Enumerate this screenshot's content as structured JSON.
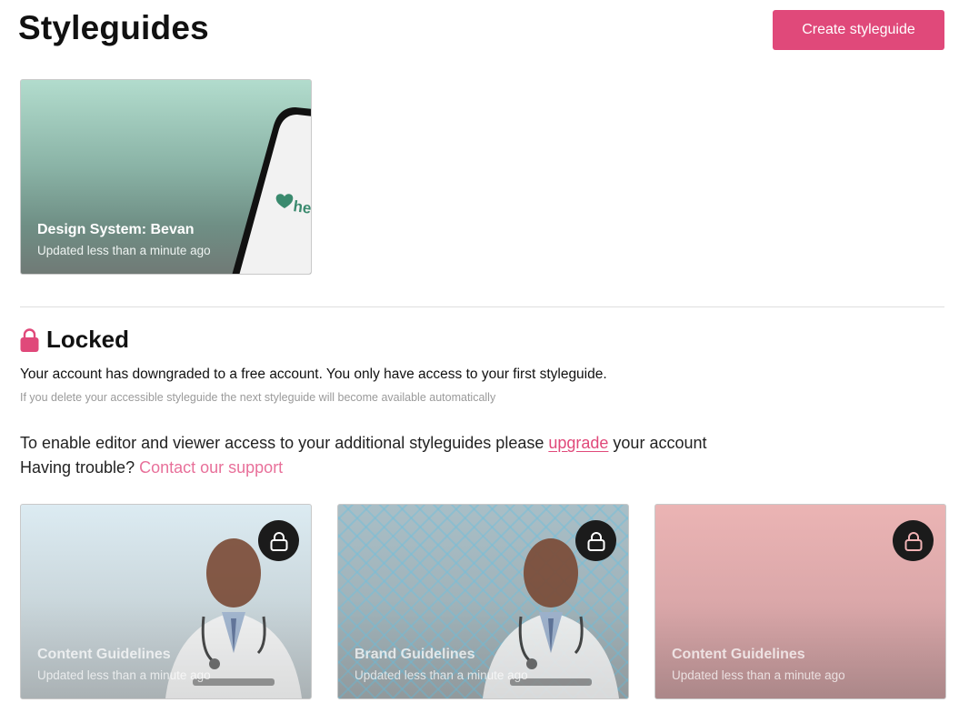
{
  "header": {
    "title": "Styleguides",
    "create_button_label": "Create styleguide"
  },
  "active_styleguides": [
    {
      "title": "Design System: Bevan",
      "updated": "Updated less than a minute ago",
      "phone_logo_text": "hea"
    }
  ],
  "locked_section": {
    "title": "Locked",
    "downgrade_message": "Your account has downgraded to a free account. You only have access to your first styleguide.",
    "delete_note": "If you delete your accessible styleguide the next styleguide will become available automatically",
    "upgrade_prefix": "To enable editor and viewer access to your additional styleguides please ",
    "upgrade_link": "upgrade",
    "upgrade_suffix": " your account",
    "trouble_prefix": "Having trouble? ",
    "support_link": "Contact our support"
  },
  "locked_styleguides": [
    {
      "title": "Content Guidelines",
      "updated": "Updated less than a minute ago"
    },
    {
      "title": "Brand Guidelines",
      "updated": "Updated less than a minute ago"
    },
    {
      "title": "Content Guidelines",
      "updated": "Updated less than a minute ago"
    }
  ],
  "colors": {
    "accent": "#e0497a",
    "link": "#e8709a",
    "lock_badge": "#1b1b1b"
  },
  "icons": {
    "locked_heading": "padlock-icon",
    "card_badge": "lock-icon"
  }
}
